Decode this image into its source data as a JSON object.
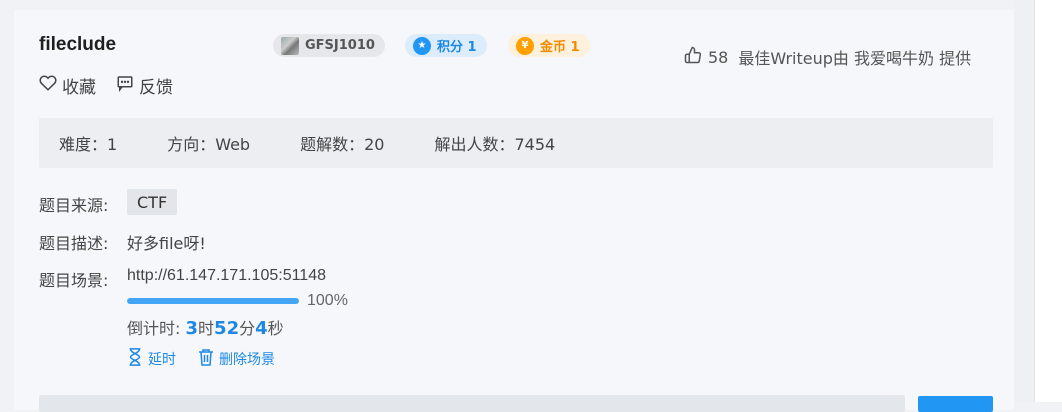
{
  "challenge": {
    "title": "fileclude",
    "badges": {
      "source_tag": "GFSJ1010",
      "points": "积分 1",
      "coins": "金币 1"
    },
    "likes": {
      "count": "58",
      "best_writeup": "最佳Writeup由 我爱喝牛奶 提供"
    },
    "actions": {
      "favorite": "收藏",
      "feedback": "反馈"
    },
    "stats": {
      "difficulty": "难度：1",
      "direction": "方向：Web",
      "solutions": "题解数：20",
      "solvers": "解出人数：7454"
    },
    "source_label": "题目来源:",
    "source_value": "CTF",
    "desc_label": "题目描述:",
    "desc_value": "好多file呀!",
    "scene_label": "题目场景:",
    "scene_url": "http://61.147.171.105:51148",
    "progress": {
      "value": 1.0,
      "text": "100%"
    },
    "countdown": {
      "prefix": "倒计时:",
      "hours": "3",
      "hours_unit": "时",
      "minutes": "52",
      "minutes_unit": "分",
      "seconds": "4",
      "seconds_unit": "秒"
    },
    "ops": {
      "extend": "延时",
      "delete_scene": "删除场景"
    }
  },
  "colors": {
    "accent": "#1e88e5",
    "progress": "#42a5f5",
    "coin": "#f08c00"
  },
  "icons": [
    "heart-icon",
    "comment-icon",
    "thumb-up-icon",
    "hourglass-icon",
    "trash-icon",
    "points-icon",
    "coin-icon"
  ]
}
